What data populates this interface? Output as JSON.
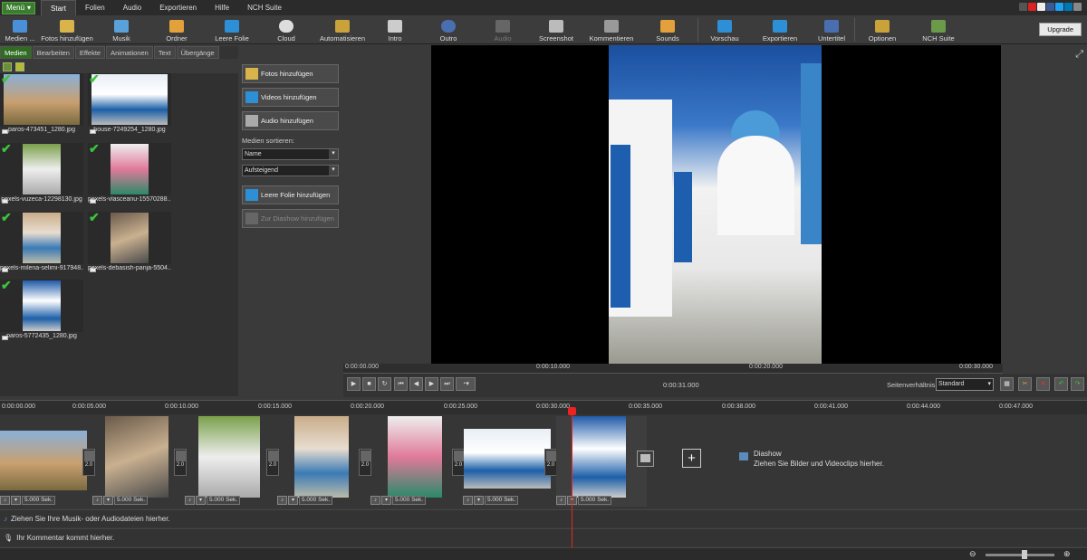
{
  "menubar": {
    "menu": "Menü",
    "tabs": [
      "Start",
      "Folien",
      "Audio",
      "Exportieren",
      "Hilfe",
      "NCH Suite"
    ]
  },
  "toolbar": {
    "items": [
      "Medien ...",
      "Fotos hinzufügen",
      "Musik",
      "Ordner",
      "Leere Folie",
      "Cloud",
      "Automatisieren",
      "Intro",
      "Outro",
      "Audio",
      "Screenshot",
      "Kommentieren",
      "Sounds",
      "Vorschau",
      "Exportieren",
      "Untertitel",
      "Optionen",
      "NCH Suite"
    ],
    "upgrade": "Upgrade"
  },
  "lefttabs": [
    "Medien",
    "Bearbeiten",
    "Effekte",
    "Animationen",
    "Text",
    "Übergänge"
  ],
  "media": [
    {
      "name": "paros-473451_1280.jpg",
      "checked": true
    },
    {
      "name": "house-7249254_1280.jpg",
      "checked": true
    },
    {
      "name": "pexels-vuzeca-12298130.jpg",
      "checked": true
    },
    {
      "name": "pexels-vlasceanu-15570288...",
      "checked": true
    },
    {
      "name": "pexels-milena-selimi-917948...",
      "checked": true
    },
    {
      "name": "pexels-debasish-panja-5504...",
      "checked": true
    },
    {
      "name": "paros-5772435_1280.jpg",
      "checked": true
    }
  ],
  "actions": {
    "add_photos": "Fotos hinzufügen",
    "add_videos": "Videos hinzufügen",
    "add_audio": "Audio hinzufügen",
    "sort_label": "Medien sortieren:",
    "sort_by": "Name",
    "sort_order": "Aufsteigend",
    "add_empty": "Leere Folie hinzufügen",
    "add_to_slideshow": "Zur Diashow hinzufügen"
  },
  "preview_ruler": [
    "0:00:00.000",
    "0:00:10.000",
    "0:00:20.000",
    "0:00:30.000"
  ],
  "controls": {
    "timecode": "0:00:31.000",
    "aspect_label": "Seitenverhältnis:",
    "aspect_value": "Standard"
  },
  "timeline_ruler": [
    "0:00:00.000",
    "0:00:05.000",
    "0:00:10.000",
    "0:00:15.000",
    "0:00:20.000",
    "0:00:25.000",
    "0:00:30.000",
    "0:00:35.000",
    "0:00:38.000",
    "0:00:41.000",
    "0:00:44.000",
    "0:00:47.000"
  ],
  "clips": [
    {
      "duration": "5.000 Sek.",
      "transition": "2.0"
    },
    {
      "duration": "5.000 Sek.",
      "transition": "2.0"
    },
    {
      "duration": "5.000 Sek.",
      "transition": "2.0"
    },
    {
      "duration": "5.000 Sek.",
      "transition": "2.0"
    },
    {
      "duration": "5.000 Sek.",
      "transition": "2.0"
    },
    {
      "duration": "5.000 Sek.",
      "transition": "2.0"
    },
    {
      "duration": "5.000 Sek.",
      "transition": ""
    }
  ],
  "diashow": {
    "title": "Diashow",
    "hint": "Ziehen Sie Bilder und Videoclips hierher."
  },
  "audio_hint": "Ziehen Sie Ihre Musik- oder Audiodateien hierher.",
  "comment_hint": "Ihr Kommentar kommt hierher."
}
